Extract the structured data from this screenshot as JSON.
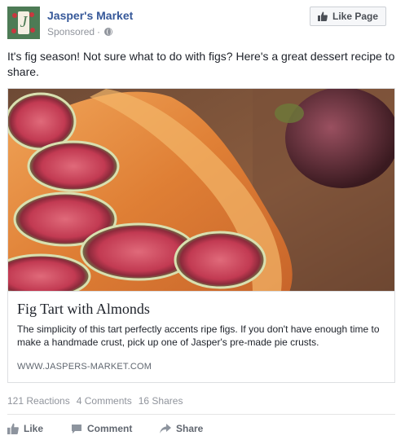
{
  "page": {
    "name": "Jasper's Market",
    "sponsored_label": "Sponsored",
    "separator": "·",
    "like_page_label": "Like Page",
    "avatar_letter": "J"
  },
  "post": {
    "text": "It's fig season! Not sure what to do with figs? Here's a great dessert recipe to share."
  },
  "link_card": {
    "headline": "Fig Tart with Almonds",
    "description": "The simplicity of this tart perfectly accents ripe figs. If you don't have enough time to make a handmade crust, pick up one of Jasper's pre-made pie crusts.",
    "domain": "WWW.JASPERS-MARKET.COM"
  },
  "stats": {
    "reactions": "121 Reactions",
    "comments": "4 Comments",
    "shares": "16 Shares"
  },
  "actions": {
    "like": "Like",
    "comment": "Comment",
    "share": "Share"
  },
  "colors": {
    "link_blue": "#365899",
    "meta_gray": "#90949c",
    "action_gray": "#616770",
    "border": "#dddfe2"
  },
  "icons": {
    "like_page": "thumbs-up-icon",
    "privacy": "globe-icon",
    "like": "thumbs-up-icon",
    "comment": "speech-bubble-icon",
    "share": "share-arrow-icon"
  }
}
